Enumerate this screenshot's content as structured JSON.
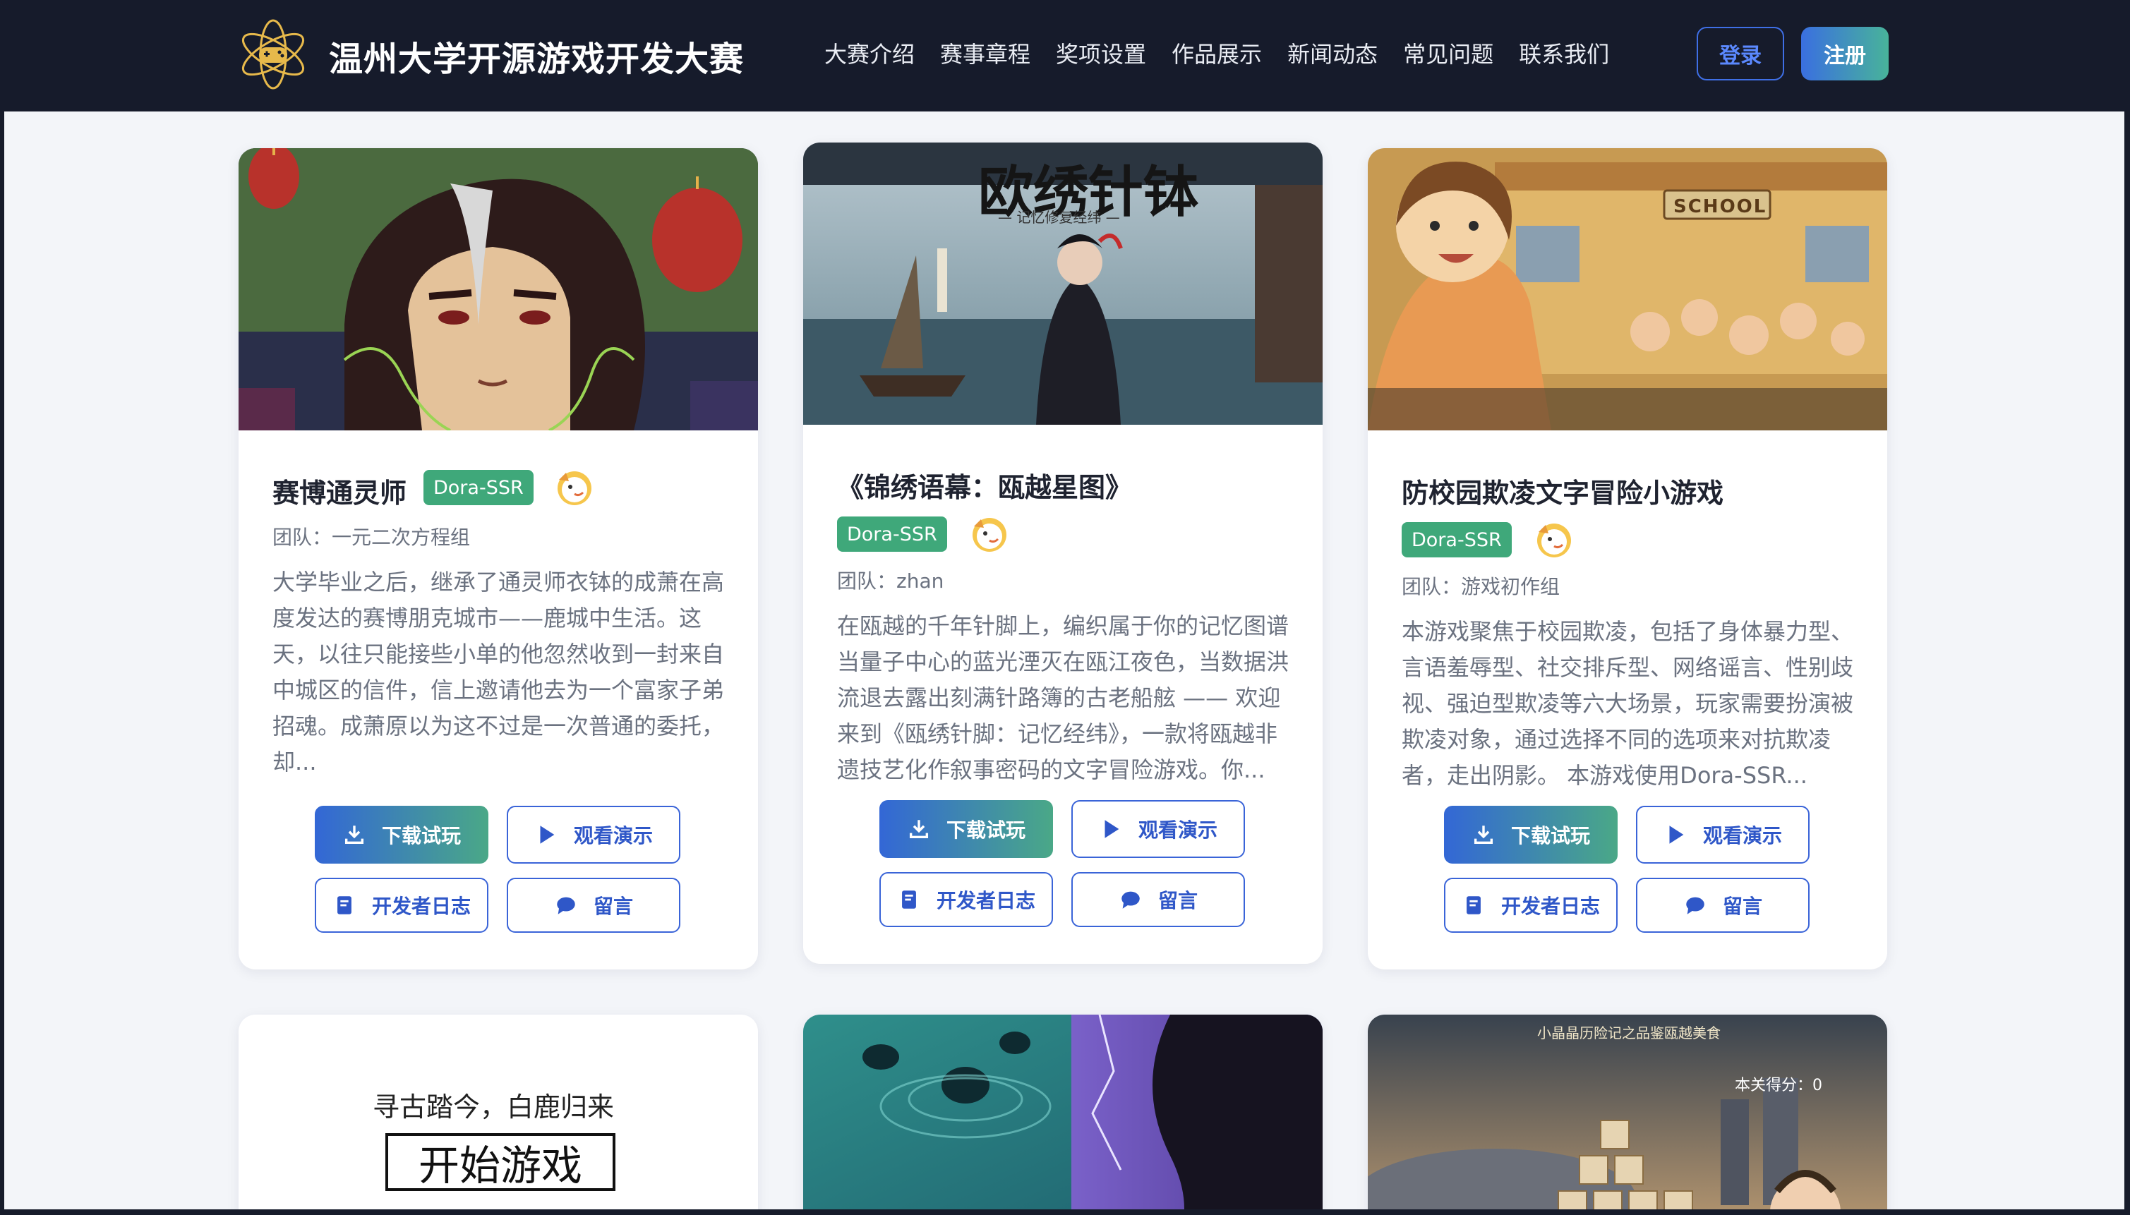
{
  "header": {
    "brand": "温州大学开源游戏开发大赛",
    "nav": [
      "大赛介绍",
      "赛事章程",
      "奖项设置",
      "作品展示",
      "新闻动态",
      "常见问题",
      "联系我们"
    ],
    "login": "登录",
    "register": "注册"
  },
  "buttons": {
    "download": "下载试玩",
    "demo": "观看演示",
    "devlog": "开发者日志",
    "comment": "留言"
  },
  "cards": [
    {
      "title": "赛博通灵师",
      "tag": "Dora-SSR",
      "team": "团队：一元二次方程组",
      "desc": "大学毕业之后，继承了通灵师衣钵的成萧在高度发达的赛博朋克城市——鹿城中生活。这天，以往只能接些小单的他忽然收到一封来自中城区的信件，信上邀请他去为一个富家子弟招魂。成萧原以为这不过是一次普通的委托，却..."
    },
    {
      "title": "《锦绣语幕：瓯越星图》",
      "tag": "Dora-SSR",
      "team": "团队：zhan",
      "desc": "在瓯越的千年针脚上，编织属于你的记忆图谱当量子中心的蓝光湮灭在瓯江夜色，当数据洪流退去露出刻满针路簿的古老船舷 —— 欢迎来到《瓯绣针脚：记忆经纬》，一款将瓯越非遗技艺化作叙事密码的文字冒险游戏。你...",
      "img_text": {
        "title": "欧绣针钵",
        "subtitle": "— 记忆修复经纬 —"
      }
    },
    {
      "title": "防校园欺凌文字冒险小游戏",
      "tag": "Dora-SSR",
      "team": "团队：游戏初作组",
      "desc": "本游戏聚焦于校园欺凌，包括了身体暴力型、言语羞辱型、社交排斥型、网络谣言、性别歧视、强迫型欺凌等六大场景，玩家需要扮演被欺凌对象，通过选择不同的选项来对抗欺凌者，走出阴影。 本游戏使用Dora-SSR...",
      "img_text": {
        "sign": "SCHOOL"
      }
    }
  ],
  "row2": {
    "card1_line1": "寻古踏今，白鹿归来",
    "card1_button": "开始游戏",
    "card3_title": "小晶晶历险记之品鉴瓯越美食",
    "card3_score": "本关得分：0"
  }
}
